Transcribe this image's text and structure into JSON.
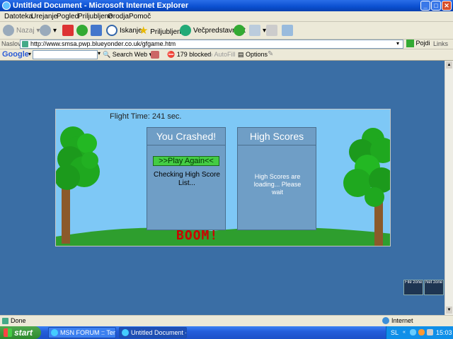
{
  "window": {
    "title": "Untitled Document - Microsoft Internet Explorer"
  },
  "menu": [
    "Datoteka",
    "Urejanje",
    "Pogled",
    "Priljubljene",
    "Orodja",
    "Pomoč"
  ],
  "toolbar": {
    "back": "Nazaj",
    "search": "Iskanje",
    "favorites": "Priljubljene",
    "media": "Večpredstavnost"
  },
  "address": {
    "label": "Naslov",
    "url": "http://www.smsa.pwp.blueyonder.co.uk/gfgame.htm",
    "go": "Pojdi",
    "links": "Links"
  },
  "google": {
    "logo": "Google",
    "search_web": "Search Web",
    "blocked": "179 blocked",
    "autofill": "AutoFill",
    "options": "Options"
  },
  "game": {
    "flight_time": "Flight Time: 241 sec.",
    "crash_title": "You Crashed!",
    "play_again": ">>Play Again<<",
    "checking": "Checking High Score List...",
    "hs_title": "High Scores",
    "hs_loading": "High Scores are loading... Please wait",
    "boom": "BOOM!"
  },
  "zones": {
    "file": "File zone",
    "net": "Net zone"
  },
  "status": {
    "text": "Done",
    "zone": "Internet"
  },
  "taskbar": {
    "start": "start",
    "tasks": [
      "MSN FORUM :: Tema ...",
      "Untitled Document - ..."
    ],
    "lang": "SL",
    "clock": "15:03"
  }
}
